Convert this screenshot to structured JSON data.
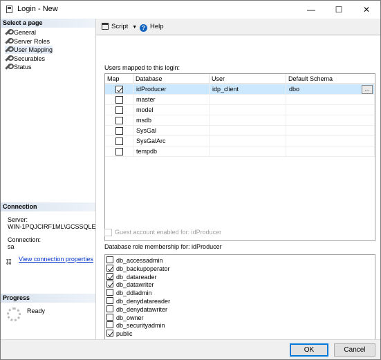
{
  "window": {
    "title": "Login - New",
    "minimize": "—",
    "maximize": "☐",
    "close": "✕"
  },
  "left": {
    "select_page_header": "Select a page",
    "pages": [
      {
        "label": "General"
      },
      {
        "label": "Server Roles"
      },
      {
        "label": "User Mapping"
      },
      {
        "label": "Securables"
      },
      {
        "label": "Status"
      }
    ],
    "connection_header": "Connection",
    "server_label": "Server:",
    "server_value": "WIN-1PQJCIRF1ML\\GCSSQLEXP",
    "connection_label": "Connection:",
    "connection_value": "sa",
    "view_props_link": "View connection properties",
    "progress_header": "Progress",
    "progress_status": "Ready"
  },
  "toolbar": {
    "script_label": "Script",
    "help_label": "Help"
  },
  "users_mapped_label": "Users mapped to this login:",
  "grid": {
    "columns": [
      "Map",
      "Database",
      "User",
      "Default Schema"
    ],
    "rows": [
      {
        "checked": true,
        "database": "idProducer",
        "user": "idp_client",
        "schema": "dbo",
        "selected": true
      },
      {
        "checked": false,
        "database": "master",
        "user": "",
        "schema": ""
      },
      {
        "checked": false,
        "database": "model",
        "user": "",
        "schema": ""
      },
      {
        "checked": false,
        "database": "msdb",
        "user": "",
        "schema": ""
      },
      {
        "checked": false,
        "database": "SysGal",
        "user": "",
        "schema": ""
      },
      {
        "checked": false,
        "database": "SysGalArc",
        "user": "",
        "schema": ""
      },
      {
        "checked": false,
        "database": "tempdb",
        "user": "",
        "schema": ""
      }
    ],
    "ellipsis": "..."
  },
  "guest_label": "Guest account enabled for: idProducer",
  "roles_label": "Database role membership for: idProducer",
  "roles": [
    {
      "name": "db_accessadmin",
      "checked": false
    },
    {
      "name": "db_backupoperator",
      "checked": true
    },
    {
      "name": "db_datareader",
      "checked": true
    },
    {
      "name": "db_datawriter",
      "checked": true
    },
    {
      "name": "db_ddladmin",
      "checked": false
    },
    {
      "name": "db_denydatareader",
      "checked": false
    },
    {
      "name": "db_denydatawriter",
      "checked": false
    },
    {
      "name": "db_owner",
      "checked": false
    },
    {
      "name": "db_securityadmin",
      "checked": false
    },
    {
      "name": "public",
      "checked": true
    }
  ],
  "buttons": {
    "ok": "OK",
    "cancel": "Cancel"
  },
  "colors": {
    "selection": "#cce8ff",
    "accent": "#0078d7",
    "link": "#0033cc"
  }
}
